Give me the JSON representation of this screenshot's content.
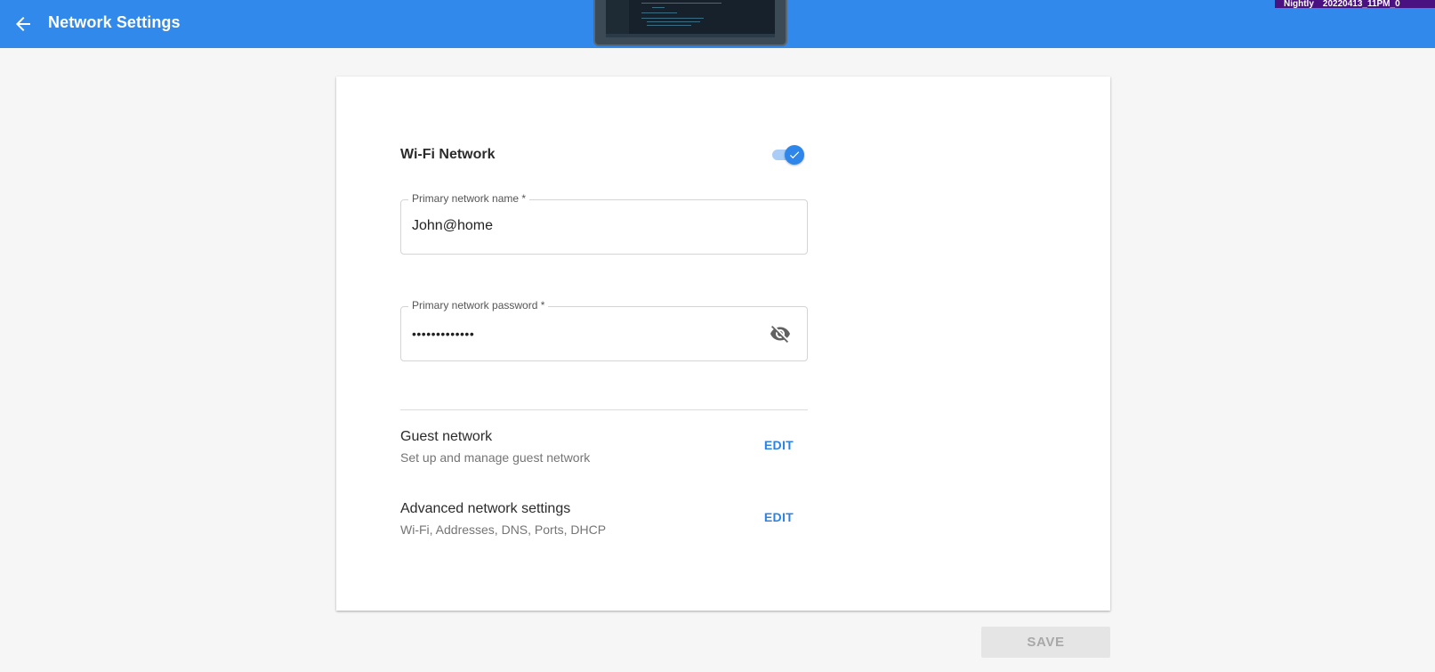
{
  "header": {
    "title": "Network Settings",
    "back_icon": "arrow-left-icon",
    "build_badge": {
      "channel": "Nightly",
      "build": "20220413_11PM_0"
    },
    "colors": {
      "bar": "#3289ec",
      "badge": "#4a1180"
    }
  },
  "wifi": {
    "label": "Wi-Fi Network",
    "enabled": true,
    "toggle_color": "#2f86ea"
  },
  "fields": {
    "name": {
      "label": "Primary network name *",
      "value": "John@home"
    },
    "password": {
      "label": "Primary network password *",
      "value": "•••••••••••••",
      "visibility_icon": "eye-off-icon"
    }
  },
  "settings": [
    {
      "title": "Guest network",
      "subtitle": "Set up and manage guest network",
      "action": "EDIT"
    },
    {
      "title": "Advanced network settings",
      "subtitle": "Wi-Fi, Addresses, DNS, Ports, DHCP",
      "action": "EDIT"
    }
  ],
  "footer": {
    "save_label": "SAVE",
    "save_enabled": false
  }
}
